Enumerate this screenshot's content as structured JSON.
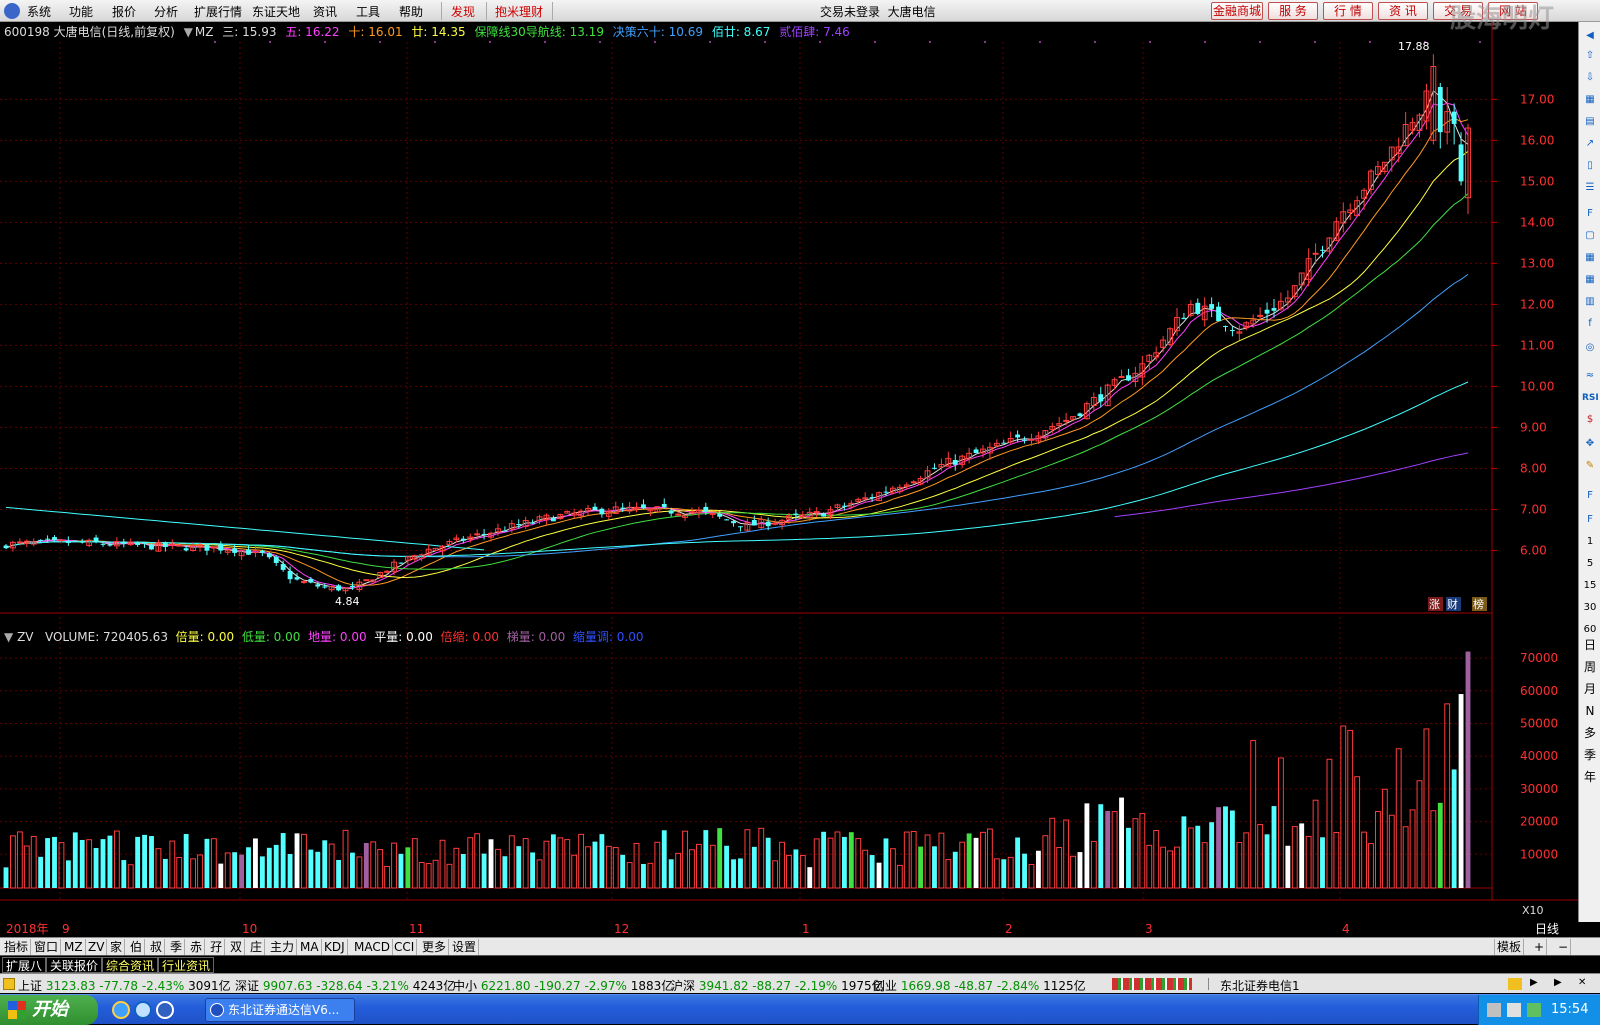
{
  "menu": {
    "items": [
      "系统",
      "功能",
      "报价",
      "分析",
      "扩展行情",
      "东证天地",
      "资讯",
      "工具",
      "帮助"
    ],
    "hot1": "发现",
    "hot2": "抱米理财",
    "center": "交易未登录  大唐电信",
    "right_buttons": [
      "金融商城",
      "服  务",
      "行  情",
      "资  讯",
      "交  易",
      "网  站"
    ],
    "watermark": "股海明灯"
  },
  "info": {
    "code_name": "600198 大唐电信",
    "period": "(日线,前复权)",
    "indicator": "MZ",
    "san": "三: 15.93",
    "wu": "五: 16.22",
    "shi": "十: 16.01",
    "nian": "廿: 14.35",
    "baozhang": "保障线30导航线: 13.19",
    "juece": "决策六十: 10.69",
    "baishi": "佰廿: 8.67",
    "ersi": "贰佰肆: 7.46"
  },
  "vol_info": {
    "name": "ZV",
    "volume": "VOLUME: 720405.63",
    "beiliang": "倍量: 0.00",
    "diliang1": "低量: 0.00",
    "diliang2": "地量: 0.00",
    "pingliang": "平量: 0.00",
    "beisuo": "倍缩: 0.00",
    "tiliang": "梯量: 0.00",
    "suoliang": "缩量调: 0.00"
  },
  "chart_data": {
    "type": "candlestick",
    "price_axis": [
      "17.00",
      "16.00",
      "15.00",
      "14.00",
      "13.00",
      "12.00",
      "11.00",
      "10.00",
      "9.00",
      "8.00",
      "7.00",
      "6.00"
    ],
    "vol_axis": [
      "70000",
      "60000",
      "50000",
      "40000",
      "30000",
      "20000",
      "10000"
    ],
    "vol_unit": "X10",
    "high_label": "17.88",
    "low_label": "4.84",
    "months": [
      "2018年",
      "9",
      "10",
      "11",
      "12",
      "1",
      "2",
      "3",
      "4"
    ],
    "period_label": "日线",
    "badges": [
      "涨",
      "财",
      "榜"
    ]
  },
  "right_tools": [
    "60",
    "30",
    "15",
    "5",
    "1"
  ],
  "right_tools2": [
    "日",
    "周",
    "月",
    "N",
    "多",
    "季",
    "年"
  ],
  "tabs": [
    "指标",
    "窗口",
    "MZ",
    "ZV",
    "家",
    "伯",
    "叔",
    "季",
    "赤",
    "孖",
    "双",
    "庄",
    "主力",
    "MA",
    "KDJ",
    "MACD",
    "CCI",
    "更多",
    "设置"
  ],
  "tab_right": "模板",
  "tabs2": [
    "扩展八",
    "关联报价",
    "综合资讯",
    "行业资讯"
  ],
  "status": [
    {
      "name": "上证",
      "val": "3123.83",
      "chg": "-77.78",
      "pct": "-2.43%",
      "amt": "3091亿"
    },
    {
      "name": "深证",
      "val": "9907.63",
      "chg": "-328.64",
      "pct": "-3.21%",
      "amt": "4243亿"
    },
    {
      "name": "中小",
      "val": "6221.80",
      "chg": "-190.27",
      "pct": "-2.97%",
      "amt": "1883亿"
    },
    {
      "name": "沪深",
      "val": "3941.82",
      "chg": "-88.27",
      "pct": "-2.19%",
      "amt": "1975亿"
    },
    {
      "name": "创业",
      "val": "1669.98",
      "chg": "-48.87",
      "pct": "-2.84%",
      "amt": "1125亿"
    }
  ],
  "server": "东北证券电信1",
  "taskbar": {
    "start": "开始",
    "item": "东北证券通达信V6...",
    "time": "15:54"
  }
}
